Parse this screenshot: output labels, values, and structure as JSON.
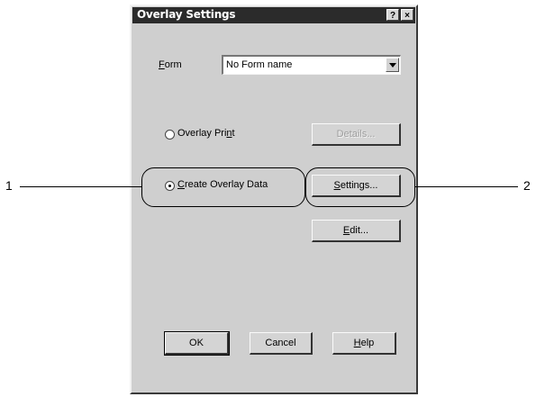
{
  "window": {
    "title": "Overlay Settings",
    "help_glyph": "?",
    "close_glyph": "×"
  },
  "form": {
    "label_prefix": "",
    "label_access_key": "F",
    "label_rest": "orm",
    "value": "No Form name"
  },
  "overlay_print": {
    "label_before": "Overlay Pri",
    "label_access_key": "n",
    "label_after": "t",
    "selected": false
  },
  "create_overlay": {
    "label_access_key": "C",
    "label_rest": "reate Overlay Data",
    "selected": true
  },
  "buttons": {
    "details": "Details...",
    "settings_access_key": "S",
    "settings_rest": "ettings...",
    "edit_access_key": "E",
    "edit_rest": "dit...",
    "ok": "OK",
    "cancel": "Cancel",
    "help_access_key": "H",
    "help_rest": "elp"
  },
  "callouts": {
    "left": "1",
    "right": "2"
  }
}
